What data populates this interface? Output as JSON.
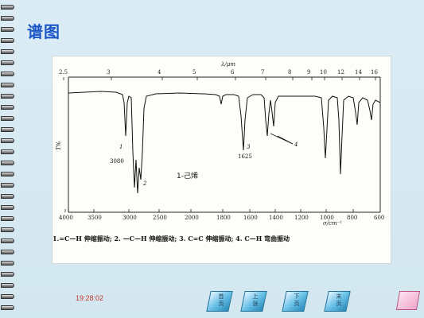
{
  "slide": {
    "title": "谱图",
    "time": "19:28:02"
  },
  "spectrum": {
    "top_axis_label": "λ/μm",
    "top_ticks": [
      "2.5",
      "3",
      "4",
      "5",
      "6",
      "7",
      "8",
      "9",
      "10",
      "12",
      "14",
      "16"
    ],
    "bottom_axis_label": "σ/cm⁻¹",
    "bottom_ticks": [
      "4000",
      "3500",
      "3000",
      "2500",
      "2000",
      "1800",
      "1600",
      "1400",
      "1200",
      "1000",
      "800",
      "600"
    ],
    "y_axis_label": "T%",
    "compound": "1-己烯",
    "peak_labels": {
      "p1_num": "1",
      "p1_value": "3080",
      "p2_num": "2",
      "p3_num": "3",
      "p3_value": "1625",
      "p4_num": "4"
    },
    "legend": "1.=C—H 伸缩振动; 2. —C—H 伸缩振动; 3. C=C 伸缩振动; 4. C—H 弯曲振动"
  },
  "nav": {
    "first": "首页",
    "prev": "上张",
    "next": "下页",
    "last": "末页"
  },
  "colors": {
    "title": "#1a56c8",
    "time": "#c23a2e",
    "nav_accent": "#2788b8"
  }
}
